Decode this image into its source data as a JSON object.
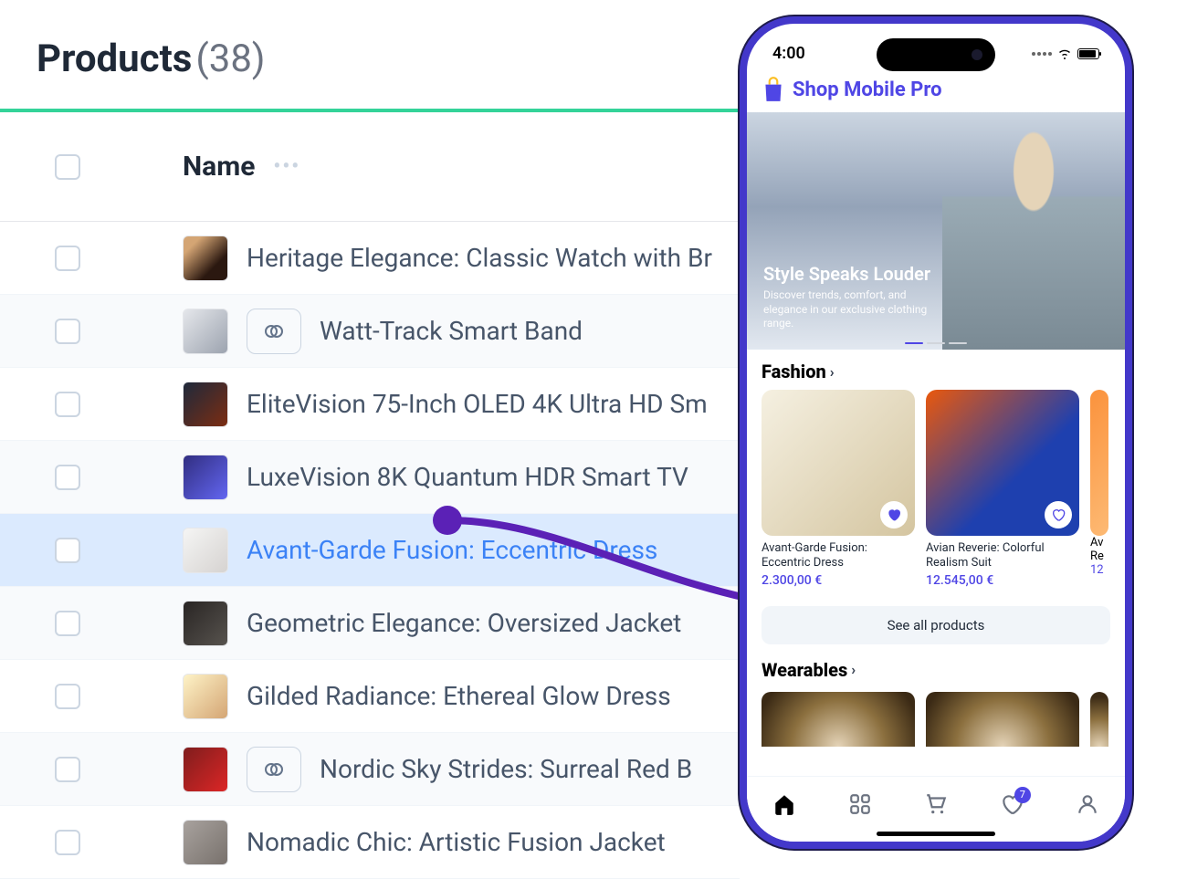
{
  "header": {
    "title": "Products",
    "count": "(38)"
  },
  "table": {
    "column_name": "Name",
    "rows": [
      {
        "name": "Heritage Elegance: Classic Watch with Br",
        "variant": false
      },
      {
        "name": "Watt-Track Smart Band",
        "variant": true
      },
      {
        "name": "EliteVision 75-Inch OLED 4K Ultra HD Sm",
        "variant": false
      },
      {
        "name": "LuxeVision 8K Quantum HDR Smart TV",
        "variant": false
      },
      {
        "name": "Avant-Garde Fusion: Eccentric Dress",
        "variant": false,
        "highlight": true
      },
      {
        "name": "Geometric Elegance: Oversized Jacket",
        "variant": false
      },
      {
        "name": "Gilded Radiance: Ethereal Glow Dress",
        "variant": false
      },
      {
        "name": "Nordic Sky Strides: Surreal Red B",
        "variant": true
      },
      {
        "name": "Nomadic Chic: Artistic Fusion Jacket",
        "variant": false
      }
    ]
  },
  "phone": {
    "time": "4:00",
    "app_name": "Shop Mobile Pro",
    "hero": {
      "title": "Style Speaks Louder",
      "subtitle": "Discover trends, comfort, and elegance in our exclusive clothing range."
    },
    "section_fashion": "Fashion",
    "section_wearables": "Wearables",
    "cards": [
      {
        "name": "Avant-Garde Fusion: Eccentric Dress",
        "price": "2.300,00 €"
      },
      {
        "name": "Avian Reverie: Colorful Realism Suit",
        "price": "12.545,00 €"
      }
    ],
    "card_peek": {
      "name_prefix": "Av",
      "name_line2": "Re",
      "price_prefix": "12"
    },
    "see_all": "See all products",
    "badge": "7"
  }
}
